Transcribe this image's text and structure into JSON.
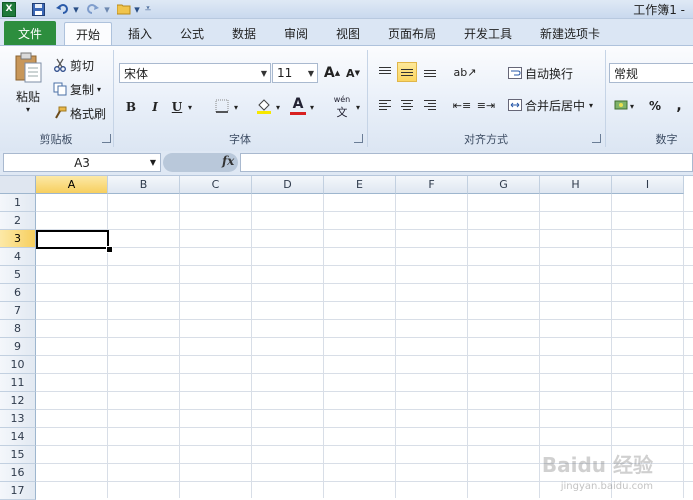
{
  "window": {
    "title": "工作簿1 -",
    "logo": "X"
  },
  "tabs": {
    "file": "文件",
    "items": [
      "开始",
      "插入",
      "公式",
      "数据",
      "审阅",
      "视图",
      "页面布局",
      "开发工具",
      "新建选项卡"
    ],
    "active": "开始"
  },
  "clipboard": {
    "paste": "粘贴",
    "cut": "剪切",
    "copy": "复制",
    "format_painter": "格式刷",
    "label": "剪贴板"
  },
  "font": {
    "name": "宋体",
    "size": "11",
    "bold": "B",
    "italic": "I",
    "underline": "U",
    "grow": "A",
    "shrink": "A",
    "font_color": "A",
    "phonetic": "wén",
    "label": "字体",
    "fill_color": "#f7e800",
    "text_color": "#d82020"
  },
  "alignment": {
    "wrap_text": "自动换行",
    "merge_center": "合并后居中",
    "label": "对齐方式"
  },
  "number": {
    "format": "常规",
    "percent": "%",
    "comma": ",",
    "label": "数字"
  },
  "formula_bar": {
    "name_box": "A3",
    "fx": "fx",
    "formula": ""
  },
  "grid": {
    "columns": [
      "A",
      "B",
      "C",
      "D",
      "E",
      "F",
      "G",
      "H",
      "I"
    ],
    "rows": [
      "1",
      "2",
      "3",
      "4",
      "5",
      "6",
      "7",
      "8",
      "9",
      "10",
      "11",
      "12",
      "13",
      "14",
      "15",
      "16",
      "17"
    ],
    "selected_column": "A",
    "selected_row": "3"
  },
  "watermark": {
    "main": "Baidu 经验",
    "sub": "jingyan.baidu.com"
  }
}
